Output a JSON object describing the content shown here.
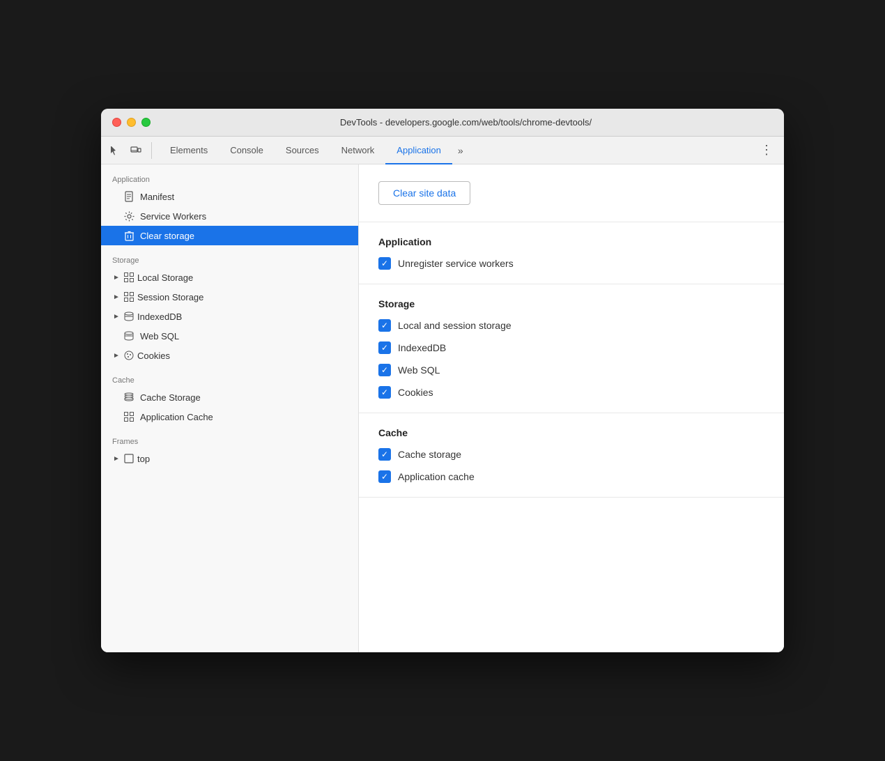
{
  "window": {
    "title": "DevTools - developers.google.com/web/tools/chrome-devtools/"
  },
  "tabs": [
    {
      "id": "elements",
      "label": "Elements",
      "active": false
    },
    {
      "id": "console",
      "label": "Console",
      "active": false
    },
    {
      "id": "sources",
      "label": "Sources",
      "active": false
    },
    {
      "id": "network",
      "label": "Network",
      "active": false
    },
    {
      "id": "application",
      "label": "Application",
      "active": true
    }
  ],
  "sidebar": {
    "sections": [
      {
        "id": "application",
        "label": "Application",
        "items": [
          {
            "id": "manifest",
            "label": "Manifest",
            "icon": "manifest",
            "hasArrow": false,
            "active": false
          },
          {
            "id": "service-workers",
            "label": "Service Workers",
            "icon": "gear",
            "hasArrow": false,
            "active": false
          },
          {
            "id": "clear-storage",
            "label": "Clear storage",
            "icon": "trash",
            "hasArrow": false,
            "active": true
          }
        ]
      },
      {
        "id": "storage",
        "label": "Storage",
        "items": [
          {
            "id": "local-storage",
            "label": "Local Storage",
            "icon": "grid",
            "hasArrow": true,
            "active": false
          },
          {
            "id": "session-storage",
            "label": "Session Storage",
            "icon": "grid",
            "hasArrow": true,
            "active": false
          },
          {
            "id": "indexed-db",
            "label": "IndexedDB",
            "icon": "db",
            "hasArrow": true,
            "active": false
          },
          {
            "id": "web-sql",
            "label": "Web SQL",
            "icon": "db",
            "hasArrow": false,
            "active": false
          },
          {
            "id": "cookies",
            "label": "Cookies",
            "icon": "cookie",
            "hasArrow": true,
            "active": false
          }
        ]
      },
      {
        "id": "cache",
        "label": "Cache",
        "items": [
          {
            "id": "cache-storage",
            "label": "Cache Storage",
            "icon": "db-stack",
            "hasArrow": false,
            "active": false
          },
          {
            "id": "application-cache",
            "label": "Application Cache",
            "icon": "grid",
            "hasArrow": false,
            "active": false
          }
        ]
      },
      {
        "id": "frames",
        "label": "Frames",
        "items": [
          {
            "id": "top",
            "label": "top",
            "icon": "frame",
            "hasArrow": true,
            "active": false
          }
        ]
      }
    ]
  },
  "panel": {
    "clear_site_data_label": "Clear site data",
    "sections": [
      {
        "id": "application",
        "title": "Application",
        "checkboxes": [
          {
            "id": "unregister-service-workers",
            "label": "Unregister service workers",
            "checked": true
          }
        ]
      },
      {
        "id": "storage",
        "title": "Storage",
        "checkboxes": [
          {
            "id": "local-session-storage",
            "label": "Local and session storage",
            "checked": true
          },
          {
            "id": "indexeddb",
            "label": "IndexedDB",
            "checked": true
          },
          {
            "id": "web-sql",
            "label": "Web SQL",
            "checked": true
          },
          {
            "id": "cookies",
            "label": "Cookies",
            "checked": true
          }
        ]
      },
      {
        "id": "cache",
        "title": "Cache",
        "checkboxes": [
          {
            "id": "cache-storage",
            "label": "Cache storage",
            "checked": true
          },
          {
            "id": "application-cache",
            "label": "Application cache",
            "checked": true
          }
        ]
      }
    ]
  }
}
